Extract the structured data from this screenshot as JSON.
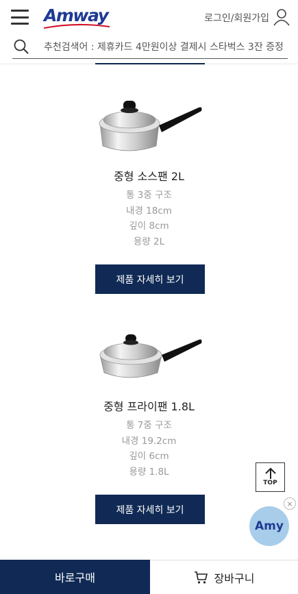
{
  "header": {
    "logo_text": "Amway",
    "login_label": "로그인/회원가입",
    "search_placeholder": "추천검색어 : 제휴카드 4만원이상 결제시 스타벅스 3잔 증정"
  },
  "products": [
    {
      "name": "중형 소스팬 2L",
      "specs": [
        "통 3중 구조",
        "내경 18cm",
        "깊이 8cm",
        "용량 2L"
      ],
      "button_label": "제품 자세히 보기"
    },
    {
      "name": "중형 프라이팬 1.8L",
      "specs": [
        "통 7중 구조",
        "내경 19.2cm",
        "깊이 6cm",
        "용량 1.8L"
      ],
      "button_label": "제품 자세히 보기"
    }
  ],
  "floating": {
    "top_label": "TOP",
    "chatbot_label": "Amy",
    "close_label": "×"
  },
  "bottom_bar": {
    "buy_now_label": "바로구매",
    "cart_label": "장바구니"
  },
  "colors": {
    "brand_navy": "#102a55",
    "logo_blue": "#1f3a93",
    "chatbot_bg": "#a8cdea"
  }
}
